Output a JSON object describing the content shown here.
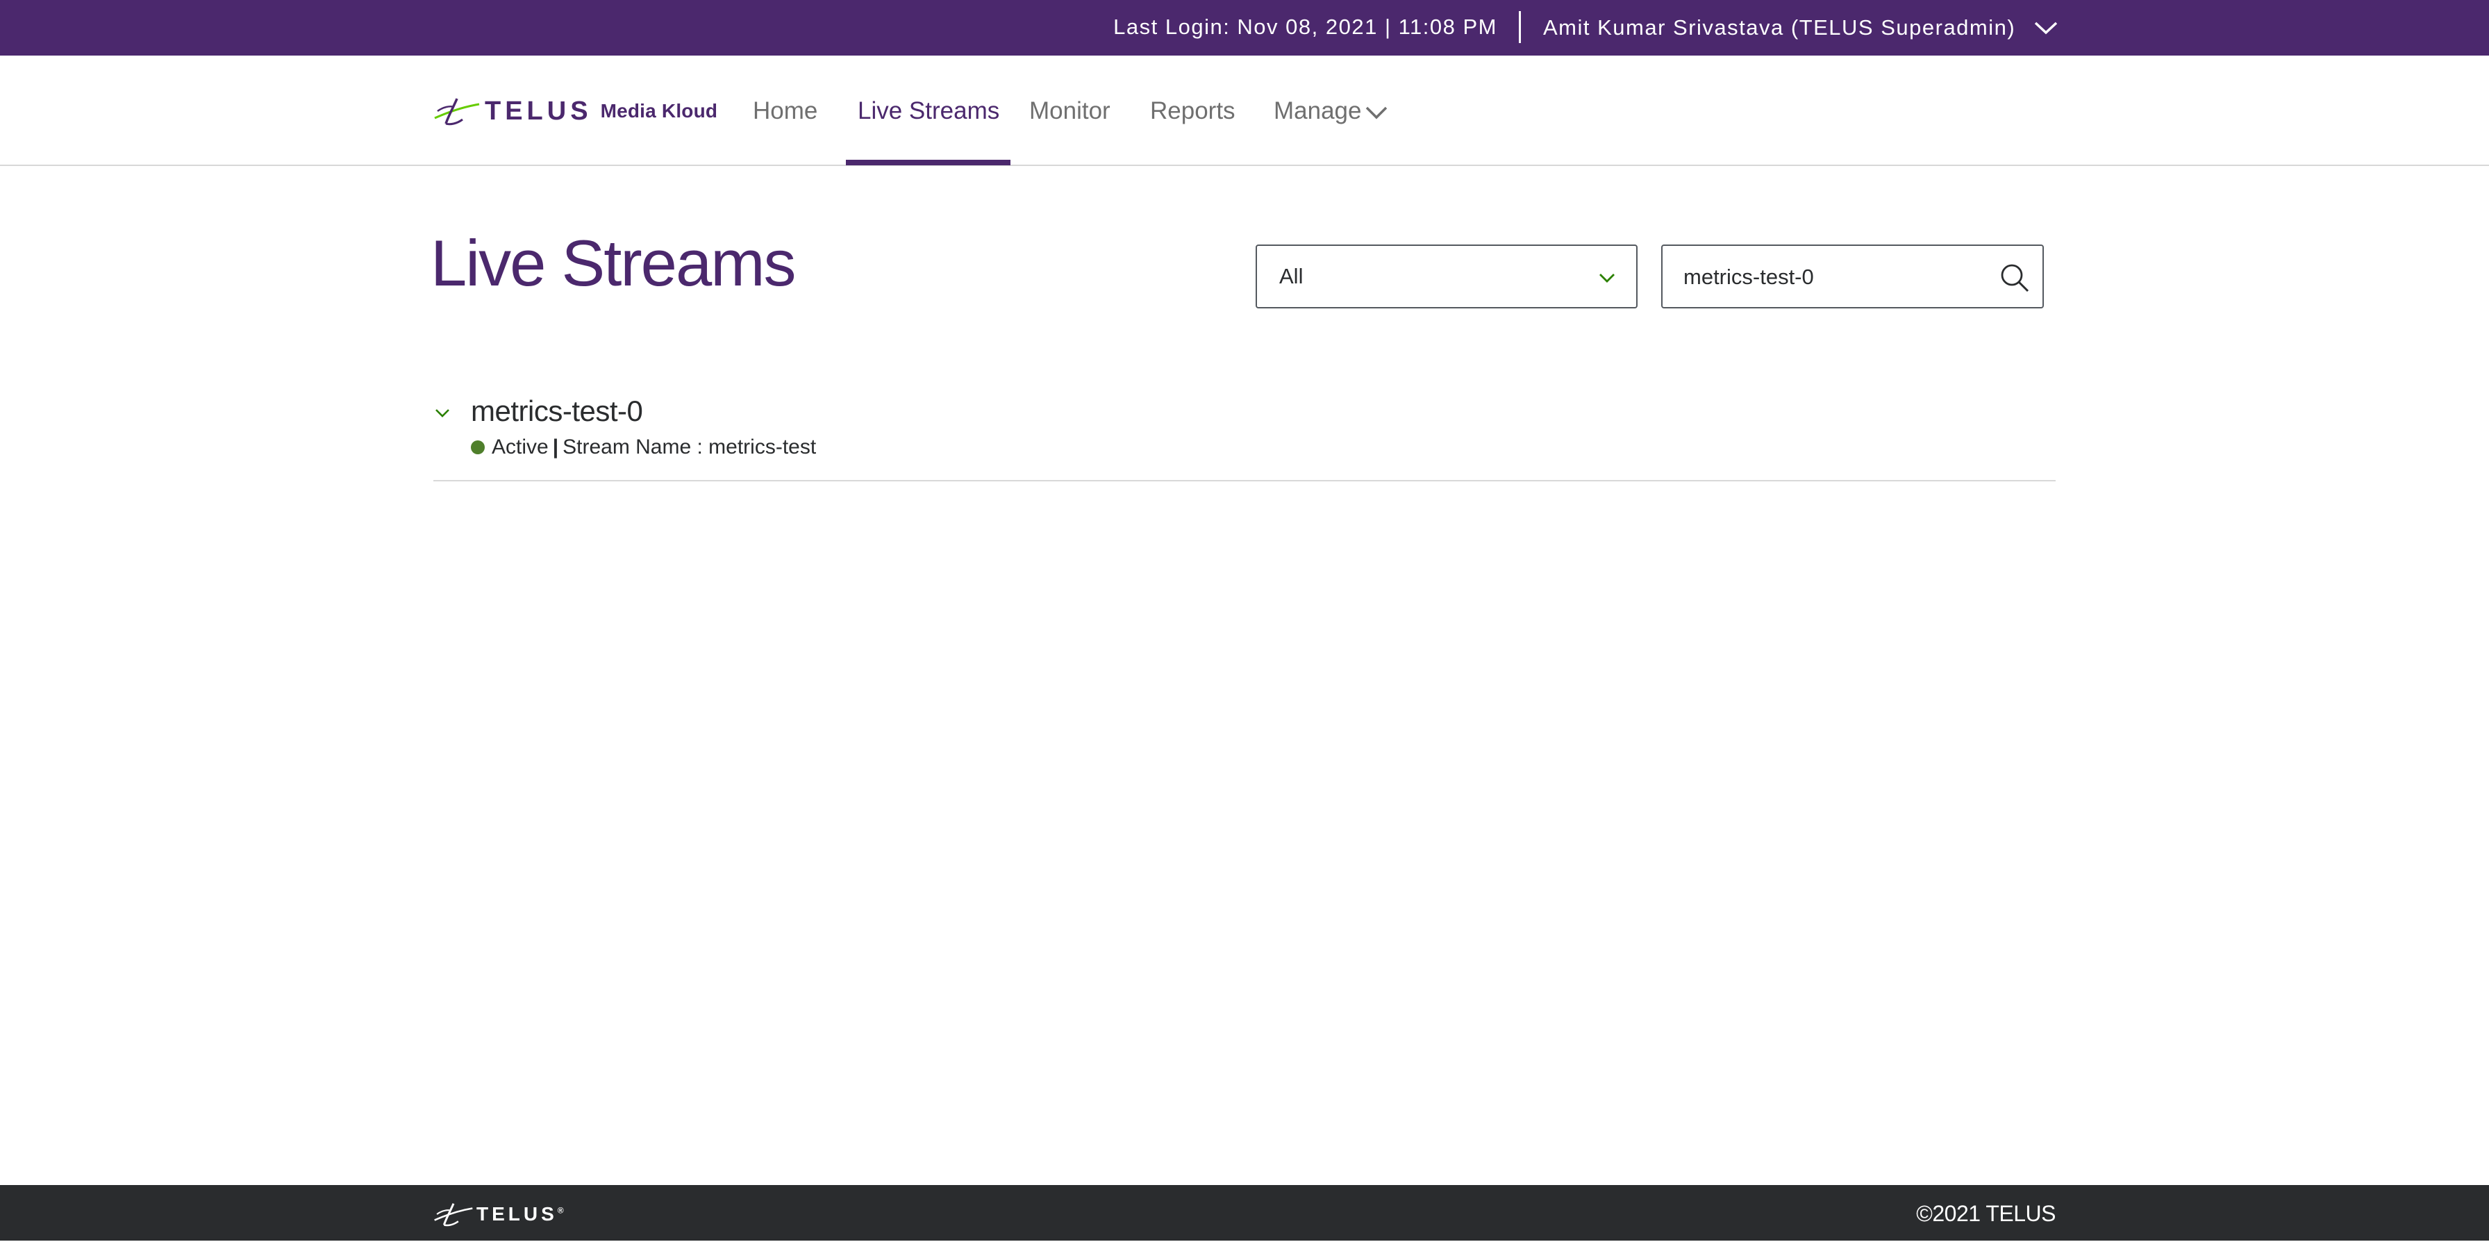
{
  "topbar": {
    "last_login": "Last Login: Nov 08, 2021 | 11:08 PM",
    "user_name": "Amit Kumar Srivastava (TELUS Superadmin)"
  },
  "logo": {
    "brand": "TELUS",
    "product": "Media Kloud"
  },
  "nav": {
    "items": [
      {
        "label": "Home",
        "active": false
      },
      {
        "label": "Live Streams",
        "active": true
      },
      {
        "label": "Monitor",
        "active": false
      },
      {
        "label": "Reports",
        "active": false
      },
      {
        "label": "Manage",
        "active": false
      }
    ]
  },
  "main": {
    "title": "Live Streams",
    "filter": {
      "selected": "All"
    },
    "search": {
      "value": "metrics-test-0",
      "placeholder": ""
    },
    "streams": [
      {
        "title": "metrics-test-0",
        "status": "Active",
        "separator": "|",
        "detail": "Stream Name : metrics-test",
        "status_color": "#4f7f2b"
      }
    ]
  },
  "footer": {
    "brand": "TELUS",
    "copyright": "©2021 TELUS"
  },
  "colors": {
    "purple": "#4b286d",
    "green": "#66cc00",
    "footer_bg": "#2a2c2e"
  },
  "icons": {
    "user_menu": "chevron-down-icon",
    "manage_menu": "chevron-down-icon",
    "filter": "chevron-down-icon",
    "search": "search-icon",
    "expand": "chevron-down-icon",
    "logo": "telus-logo-mark"
  }
}
